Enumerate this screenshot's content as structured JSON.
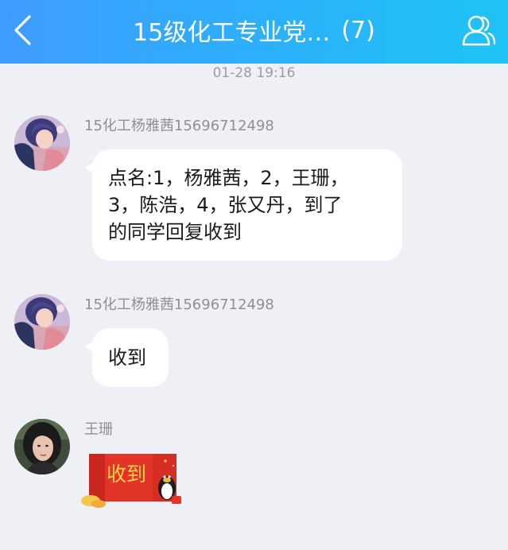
{
  "header": {
    "title": "15级化工专业党…",
    "member_count": "(7)",
    "back_icon": "chevron-left-icon",
    "profile_icon": "group-members-icon"
  },
  "timestamp": "01-28 19:16",
  "messages": [
    {
      "sender": "15化工杨雅茜15696712498",
      "text": "点名:1，杨雅茜，2，王珊，3，陈浩，4，张又丹，到了的同学回复收到",
      "lines": [
        "点名:1，杨雅茜，2，王珊，",
        "3，陈浩，4，张又丹，到了",
        "的同学回复收到"
      ]
    },
    {
      "sender": "15化工杨雅茜15696712498",
      "text": "收到"
    },
    {
      "sender": "王珊",
      "sticker_text": "收到",
      "sticker_icon": "red-envelope-sticker-icon"
    }
  ],
  "colors": {
    "header_start": "#3f9cff",
    "header_end": "#1fc3f6",
    "background": "#eff0f5",
    "bubble": "#ffffff",
    "red_envelope": "#e3342a",
    "sticker_text": "#ffd24a"
  }
}
